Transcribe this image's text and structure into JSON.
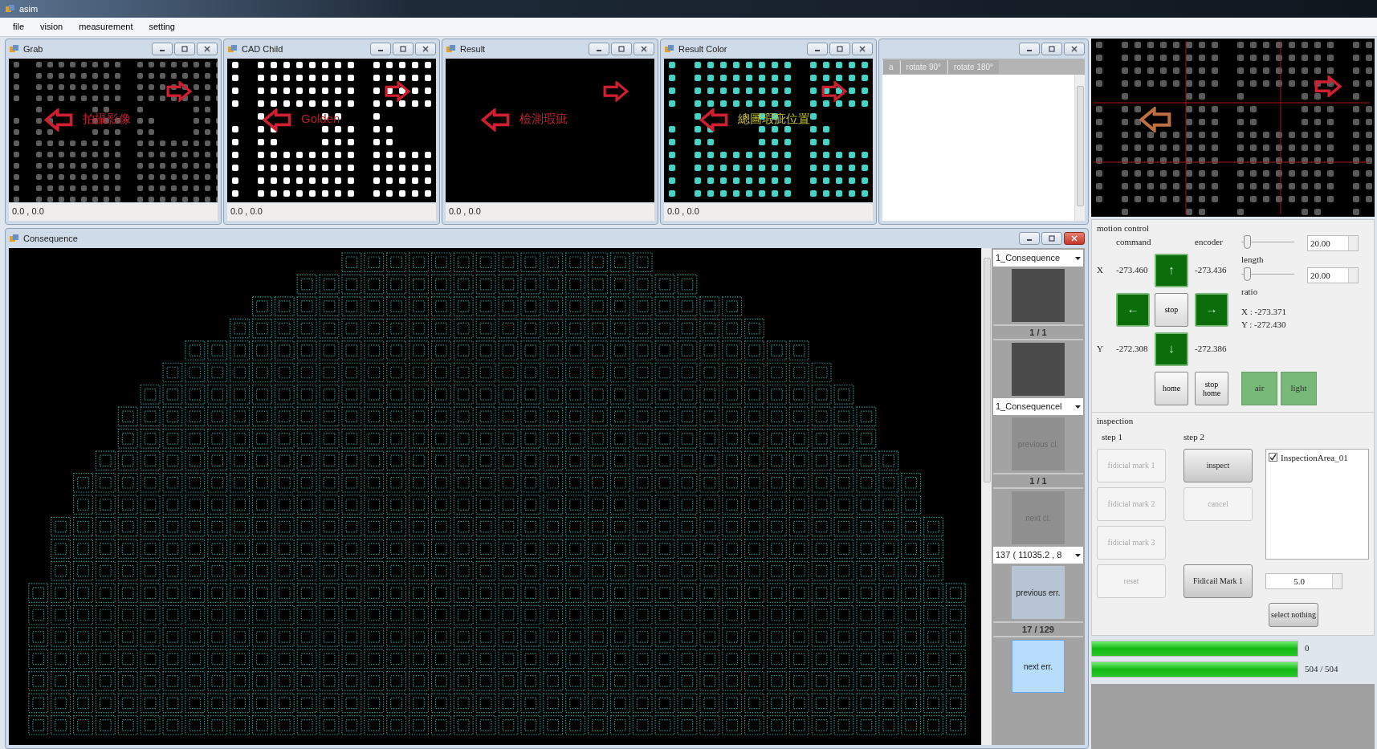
{
  "window": {
    "title": "asim"
  },
  "menu": [
    "file",
    "vision",
    "measurement",
    "setting"
  ],
  "image_windows": [
    {
      "title": "Grab",
      "kind": "gray",
      "annotation": "拍攝影像",
      "coords": "0.0 , 0.0"
    },
    {
      "title": "CAD Child",
      "kind": "white",
      "annotation": "Golden",
      "coords": "0.0 , 0.0"
    },
    {
      "title": "Result",
      "kind": "blank",
      "annotation": "檢測瑕疵",
      "coords": "0.0 , 0.0"
    },
    {
      "title": "Result Color",
      "kind": "cyan",
      "annotation": "總圖瑕疵位置",
      "coords": "0.0 , 0.0"
    }
  ],
  "side_window": {
    "tabs": [
      "a",
      "rotate 90°",
      "rotate 180°"
    ]
  },
  "consequence": {
    "title": "Consequence",
    "sidebar": [
      {
        "kind": "select",
        "value": "1_Consequence"
      },
      {
        "kind": "thumbnail"
      },
      {
        "kind": "counter",
        "text": "1 / 1"
      },
      {
        "kind": "thumbnail"
      },
      {
        "kind": "select",
        "value": "1_Consequencel"
      },
      {
        "kind": "button",
        "label": "previous cl.",
        "disabled": true,
        "focused": false
      },
      {
        "kind": "counter",
        "text": "1 / 1"
      },
      {
        "kind": "button",
        "label": "next cl.",
        "disabled": true,
        "focused": false
      },
      {
        "kind": "select",
        "value": "137 ( 11035.2 , 8"
      },
      {
        "kind": "button",
        "label": "previous err.",
        "disabled": false,
        "focused": false
      },
      {
        "kind": "counter",
        "text": "17 / 129"
      },
      {
        "kind": "button",
        "label": "next err.",
        "disabled": false,
        "focused": true
      }
    ]
  },
  "motion_control": {
    "title": "motion control",
    "command_header": "command",
    "encoder_header": "encoder",
    "axes": [
      {
        "label": "X",
        "command": "-273.460",
        "encoder": "-273.436"
      },
      {
        "label": "Y",
        "command": "-272.308",
        "encoder": "-272.386"
      }
    ],
    "jog": {
      "up": "↑",
      "left": "←",
      "stop": "stop",
      "right": "→",
      "down": "↓"
    },
    "home": "home",
    "stop_home": "stop home",
    "sliders": [
      {
        "label": "length",
        "level": 0.05,
        "value": "20.00"
      },
      {
        "label": "ratio",
        "level": 0.05,
        "value": "20.00"
      }
    ],
    "position": [
      "X : -273.371",
      "Y : -272.430"
    ],
    "toggles": [
      {
        "label": "air",
        "on": true
      },
      {
        "label": "light",
        "on": true
      }
    ]
  },
  "inspection": {
    "title": "inspection",
    "step1": {
      "title": "step 1",
      "buttons": [
        {
          "label": "fidicial mark 1",
          "disabled": true
        },
        {
          "label": "fidicial mark 2",
          "disabled": true
        },
        {
          "label": "fidicial mark 3",
          "disabled": true
        },
        {
          "label": "reset",
          "disabled": true
        }
      ]
    },
    "step2": {
      "title": "step 2",
      "buttons": [
        {
          "label": "inspect",
          "disabled": false
        },
        {
          "label": "cancel",
          "disabled": true
        },
        {
          "label": "Fidicail Mark 1",
          "disabled": false
        }
      ]
    },
    "areas": [
      {
        "label": "InspectionArea_01",
        "checked": true
      }
    ],
    "spin_value": "5.0",
    "select_nothing": "select nothing"
  },
  "progress": [
    {
      "level": 1,
      "text": "0"
    },
    {
      "level": 1,
      "text": "504 / 504"
    }
  ]
}
